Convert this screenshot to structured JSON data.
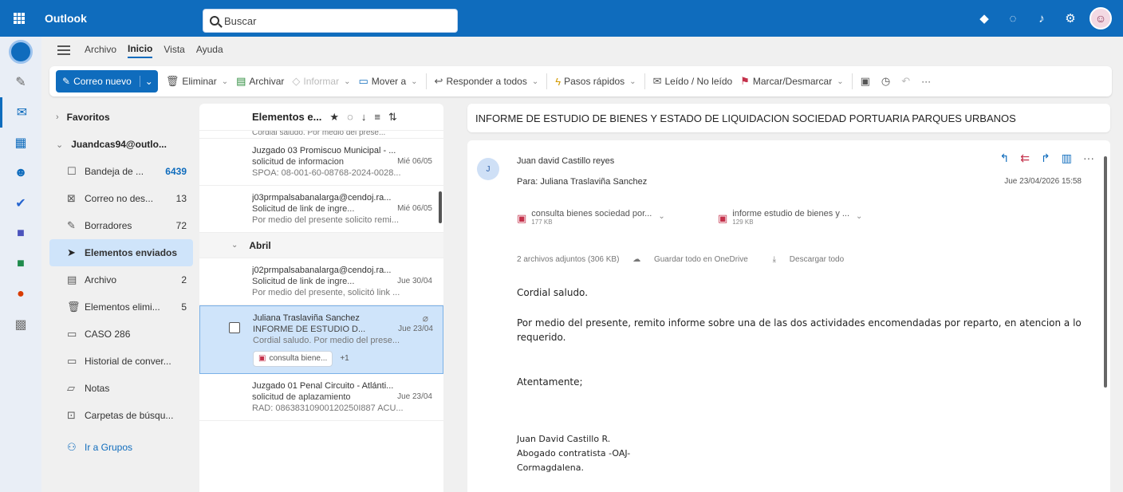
{
  "app": {
    "brand": "Outlook"
  },
  "search": {
    "placeholder": "Buscar"
  },
  "tabs": [
    "Archivo",
    "Inicio",
    "Vista",
    "Ayuda"
  ],
  "ribbon": {
    "new_mail": "Correo nuevo",
    "delete": "Eliminar",
    "archive": "Archivar",
    "report": "Informar",
    "move": "Mover a",
    "reply_all": "Responder a todos",
    "quick_steps": "Pasos rápidos",
    "read_unread": "Leído / No leído",
    "flag": "Marcar/Desmarcar",
    "more": "···"
  },
  "folders": {
    "favorites": "Favoritos",
    "account": "Juandcas94@outlo...",
    "items": [
      {
        "label": "Bandeja de ...",
        "count": "6439",
        "icon": "inbox-icon"
      },
      {
        "label": "Correo no des...",
        "count": "13",
        "icon": "junk-icon"
      },
      {
        "label": "Borradores",
        "count": "72",
        "icon": "drafts-icon"
      },
      {
        "label": "Elementos enviados",
        "count": "",
        "icon": "send-icon"
      },
      {
        "label": "Archivo",
        "count": "2",
        "icon": "archive-icon"
      },
      {
        "label": "Elementos elimi...",
        "count": "5",
        "icon": "trash-icon"
      },
      {
        "label": "CASO 286",
        "count": "",
        "icon": "folder-icon"
      },
      {
        "label": "Historial de conver...",
        "count": "",
        "icon": "folder-icon"
      },
      {
        "label": "Notas",
        "count": "",
        "icon": "notes-icon"
      },
      {
        "label": "Carpetas de búsqu...",
        "count": "",
        "icon": "search-folder-icon"
      }
    ],
    "groups_link": "Ir a Grupos"
  },
  "list": {
    "header": "Elementos e...",
    "top_cut": "Cordial saludo. Por medio del prese...",
    "messages": [
      {
        "sender": "Juzgado 03 Promiscuo Municipal - ...",
        "subject": "solicitud de informacion",
        "date": "Mié 06/05",
        "preview": "SPOA: 08-001-60-08768-2024-0028..."
      },
      {
        "sender": "j03prmpalsabanalarga@cendoj.ra...",
        "subject": "Solicitud de link de ingre...",
        "date": "Mié 06/05",
        "preview": "Por medio del presente solicito remi..."
      }
    ],
    "group": "Abril",
    "april_messages": [
      {
        "sender": "j02prmpalsabanalarga@cendoj.ra...",
        "subject": "Solicitud de link de ingre...",
        "date": "Jue 30/04",
        "preview": "Por medio del presente, solicitó link ..."
      },
      {
        "sender": "Juliana Traslaviña Sanchez",
        "subject": "INFORME DE ESTUDIO D...",
        "date": "Jue 23/04",
        "preview": "Cordial saludo. Por medio del prese...",
        "chip": "consulta biene...",
        "chip_more": "+1"
      },
      {
        "sender": "Juzgado 01 Penal Circuito - Atlánti...",
        "subject": "solicitud de aplazamiento",
        "date": "Jue 23/04",
        "preview": "RAD: 08638310900120250I887 ACU..."
      }
    ]
  },
  "reading": {
    "subject": "INFORME DE ESTUDIO DE BIENES Y ESTADO DE LIQUIDACION SOCIEDAD PORTUARIA PARQUES URBANOS",
    "avatar": "J",
    "from": "Juan david Castillo reyes",
    "to": "Para: Juliana Traslaviña Sanchez",
    "date": "Jue 23/04/2026 15:58",
    "attachments": [
      {
        "name": "consulta bienes sociedad por...",
        "size": "177 KB"
      },
      {
        "name": "informe estudio de bienes y ...",
        "size": "129 KB"
      }
    ],
    "att_summary": "2 archivos adjuntos (306 KB)",
    "save_onedrive": "Guardar todo en OneDrive",
    "download_all": "Descargar todo",
    "body": {
      "greeting": "Cordial saludo.",
      "paragraph": "Por medio del presente, remito informe sobre una de las dos actividades encomendadas por reparto, en atencion a lo requerido.",
      "closing": "Atentamente;",
      "sig_name": "Juan David Castillo R.",
      "sig_role": "Abogado contratista -OAJ-",
      "sig_org": "Cormagdalena."
    }
  }
}
